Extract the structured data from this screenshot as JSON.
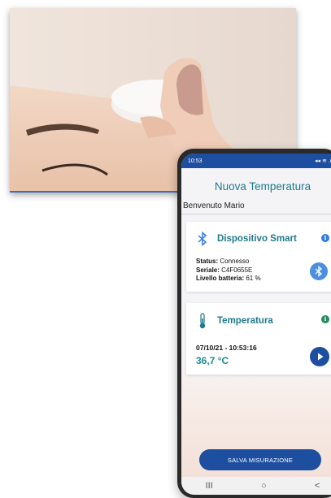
{
  "statusbar": {
    "time": "10:53",
    "extra": "⁂ ⁂",
    "signals": "◂◂ ≋ .ıl ▮"
  },
  "app": {
    "title": "Nuova Temperatura",
    "welcome": "Benvenuto Mario"
  },
  "device_card": {
    "title": "Dispositivo Smart",
    "status_label": "Status:",
    "status_value": "Connesso",
    "serial_label": "Seriale:",
    "serial_value": "C4F0655E",
    "battery_label": "Livello batteria:",
    "battery_value": "61 %",
    "info_icon": "i"
  },
  "temp_card": {
    "title": "Temperatura",
    "datetime": "07/10/21 - 10:53:16",
    "value": "36,7 °C",
    "info_icon": "i"
  },
  "save_button": "SALVA MISURAZIONE",
  "navbar": {
    "recent": "III",
    "home": "○",
    "back": "<"
  },
  "colors": {
    "primary": "#1e4ea0",
    "teal": "#1f7a8c",
    "bluetooth": "#4a8fe0"
  }
}
